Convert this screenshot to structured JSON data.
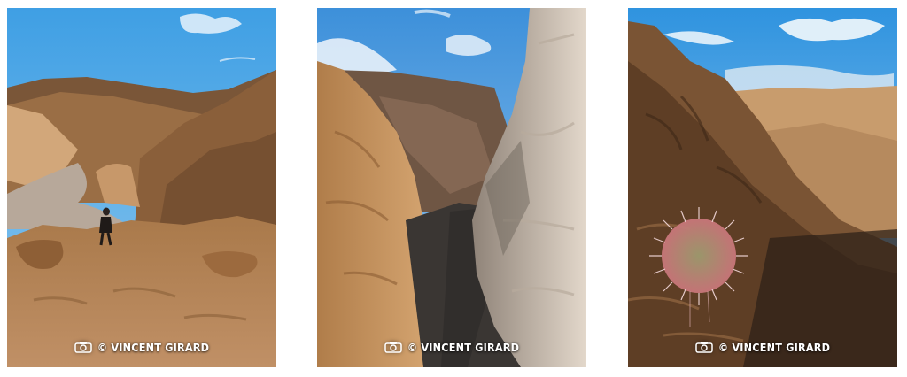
{
  "gallery": {
    "photos": [
      {
        "credit": "© VINCENT GIRARD",
        "camera_icon": "camera-icon",
        "colors": {
          "sky": "#4aa9e8",
          "rock": "#b98a55",
          "shadow": "#6e4d2e"
        }
      },
      {
        "credit": "© VINCENT GIRARD",
        "camera_icon": "camera-icon",
        "colors": {
          "sky": "#4f9fe0",
          "rock": "#c79461",
          "shadow": "#3b342e"
        }
      },
      {
        "credit": "© VINCENT GIRARD",
        "camera_icon": "camera-icon",
        "colors": {
          "sky": "#3aa0e6",
          "rock": "#9c7248",
          "shadow": "#3d2b1e"
        }
      }
    ]
  }
}
